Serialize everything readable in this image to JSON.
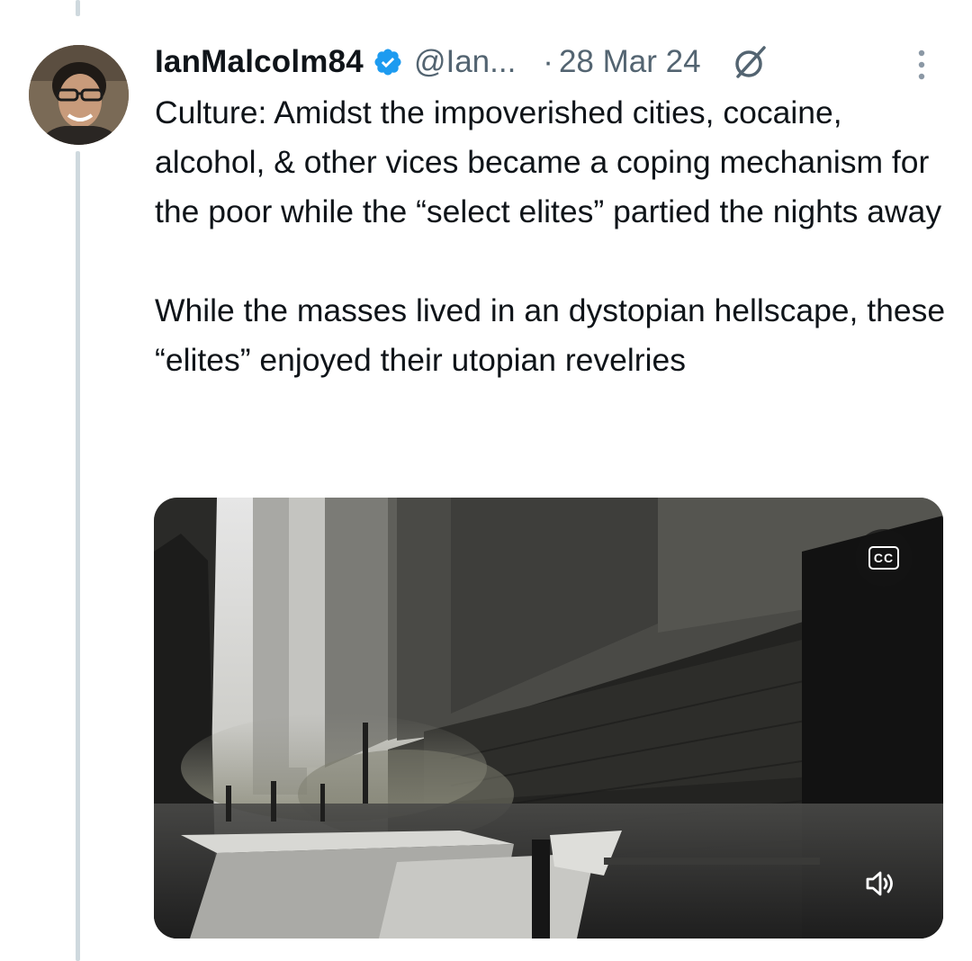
{
  "author": {
    "display_name": "IanMalcolm84",
    "handle": "@Ian...",
    "separator": "·",
    "date": "28 Mar 24",
    "verified": true
  },
  "tweet": {
    "paragraphs": [
      "Culture: Amidst the impoverished cities, cocaine, alcohol, & other vices became a coping mechanism for the poor while the “select elites” partied the nights away",
      "While the masses lived in an dystopian hellscape, these “elites” enjoyed their utopian revelries"
    ]
  },
  "media": {
    "type": "video",
    "cc_label": "CC"
  },
  "icons": {
    "verified": "verified-badge-icon",
    "grok": "grok-icon",
    "more": "more-options-icon",
    "captions": "captions-icon",
    "volume": "volume-icon"
  },
  "colors": {
    "text_primary": "#0f1419",
    "text_secondary": "#536471",
    "verified_blue": "#1d9bf0",
    "thread_line": "#cfd9de"
  }
}
